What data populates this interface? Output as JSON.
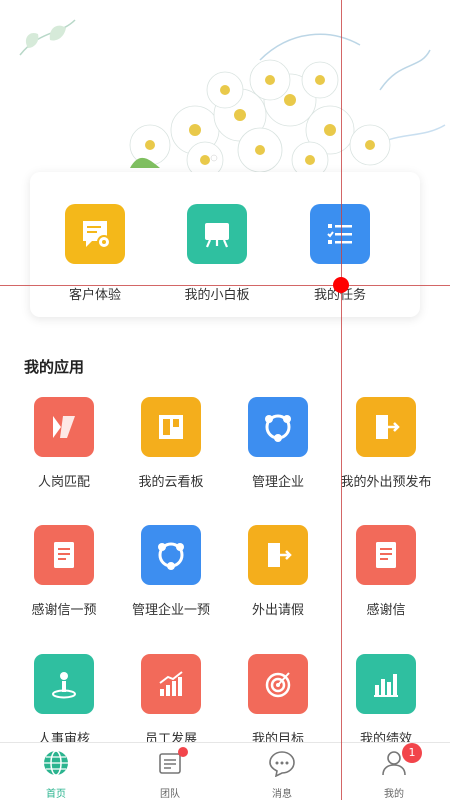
{
  "banner": {
    "image": "white-daisy-flowers"
  },
  "quick_actions": [
    {
      "label": "客户体验",
      "icon": "document-gear-icon",
      "color": "#f4b81a"
    },
    {
      "label": "我的小白板",
      "icon": "whiteboard-icon",
      "color": "#2fc0a0"
    },
    {
      "label": "我的任务",
      "icon": "task-list-icon",
      "color": "#3b8ff0"
    }
  ],
  "apps_section": {
    "title": "我的应用",
    "items": [
      {
        "label": "人岗匹配",
        "icon": "person-match-icon",
        "color": "#f26a5a"
      },
      {
        "label": "我的云看板",
        "icon": "board-icon",
        "color": "#f4ae1c"
      },
      {
        "label": "管理企业",
        "icon": "network-icon",
        "color": "#3d8ef0"
      },
      {
        "label": "我的外出预发布",
        "icon": "exit-door-icon",
        "color": "#f4ae1c"
      },
      {
        "label": "感谢信一预",
        "icon": "letter-icon",
        "color": "#f26a5a"
      },
      {
        "label": "管理企业一预",
        "icon": "network-icon",
        "color": "#3d8ef0"
      },
      {
        "label": "外出请假",
        "icon": "exit-door-icon",
        "color": "#f4ae1c"
      },
      {
        "label": "感谢信",
        "icon": "letter-icon",
        "color": "#f26a5a"
      },
      {
        "label": "人事审核",
        "icon": "person-pin-icon",
        "color": "#2fbfa0"
      },
      {
        "label": "员工发展",
        "icon": "growth-chart-icon",
        "color": "#f26a5a"
      },
      {
        "label": "我的目标",
        "icon": "target-icon",
        "color": "#f26a5a"
      },
      {
        "label": "我的绩效",
        "icon": "bar-chart-icon",
        "color": "#2fbfa0"
      }
    ]
  },
  "tabbar": {
    "tabs": [
      {
        "label": "首页",
        "icon": "globe-icon",
        "active": true
      },
      {
        "label": "团队",
        "icon": "team-card-icon",
        "badge_dot": true
      },
      {
        "label": "消息",
        "icon": "chat-bubble-icon"
      },
      {
        "label": "我的",
        "icon": "user-icon",
        "badge_count": "1"
      }
    ]
  },
  "colors": {
    "accent": "#2bb48f",
    "badge": "#f2454b"
  }
}
